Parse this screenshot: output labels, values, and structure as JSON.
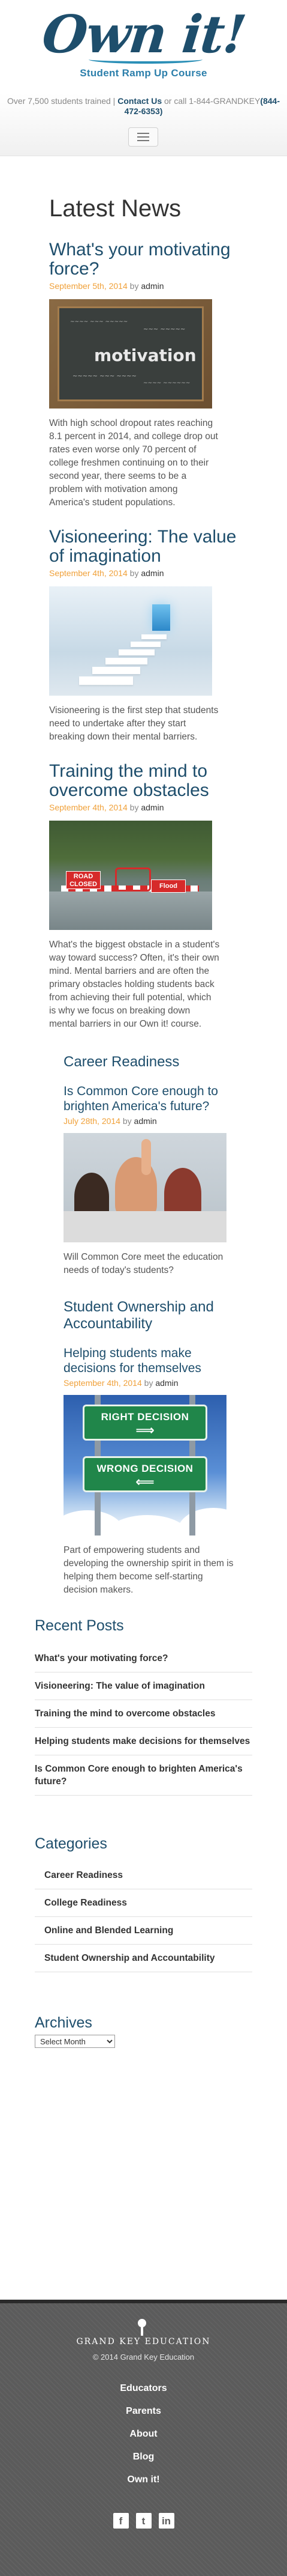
{
  "header": {
    "logo_text": "Own it!",
    "logo_tagline": "Student Ramp Up Course",
    "info_prefix": "Over 7,500 students trained |",
    "contact_link": "Contact Us",
    "info_mid": "or call 1-844-GRANDKEY",
    "phone": "(844-472-6353)",
    "menu_icon": "hamburger-menu-icon"
  },
  "main": {
    "page_title": "Latest News",
    "posts": [
      {
        "title": "What's your motivating force?",
        "date": "September 5th, 2014",
        "by": "by",
        "author": "admin",
        "excerpt": "With high school dropout rates reaching 8.1 percent in 2014, and college drop out rates even worse only 70 percent of college freshmen continuing on to their second year, there seems to be a problem with motivation among America's student populations."
      },
      {
        "title": "Visioneering: The value of imagination",
        "date": "September 4th, 2014",
        "by": "by",
        "author": "admin",
        "excerpt": "Visioneering is the first step that students need to undertake after they start breaking down their mental barriers."
      },
      {
        "title": "Training the mind to overcome obstacles",
        "date": "September 4th, 2014",
        "by": "by",
        "author": "admin",
        "excerpt": "What's the biggest obstacle in a student's way toward success? Often, it's their own mind. Mental barriers and are often the primary obstacles holding students back from achieving their full potential, which is why we focus on breaking down mental barriers in our Own it! course."
      }
    ],
    "chalkboard_word": "motivation",
    "flood_signs": [
      "ROAD CLOSED",
      "Flood"
    ],
    "categories": [
      {
        "heading": "Career Readiness",
        "post_title": "Is Common Core enough to brighten America's future?",
        "date": "July 28th, 2014",
        "by": "by",
        "author": "admin",
        "excerpt": "Will Common Core meet the education needs of today's students?"
      },
      {
        "heading": "Student Ownership and Accountability",
        "post_title": "Helping students make decisions for themselves",
        "date": "September 4th, 2014",
        "by": "by",
        "author": "admin",
        "excerpt": "Part of empowering students and developing the ownership spirit in them is helping them become self-starting decision makers."
      }
    ],
    "decision_signs": [
      "RIGHT DECISION",
      "WRONG DECISION"
    ]
  },
  "sidebar": {
    "recent_title": "Recent Posts",
    "recent_posts": [
      "What's your motivating force?",
      "Visioneering: The value of imagination",
      "Training the mind to overcome obstacles",
      "Helping students make decisions for themselves",
      "Is Common Core enough to brighten America's future?"
    ],
    "categories_title": "Categories",
    "categories": [
      "Career Readiness",
      "College Readiness",
      "Online and Blended Learning",
      "Student Ownership and Accountability"
    ],
    "archives_title": "Archives",
    "archives_select": "Select Month"
  },
  "footer": {
    "logo_name": "GRAND KEY EDUCATION",
    "copyright": "© 2014 Grand Key Education",
    "nav": [
      "Educators",
      "Parents",
      "About",
      "Blog",
      "Own it!"
    ],
    "social": [
      "facebook-icon",
      "twitter-icon",
      "linkedin-icon"
    ]
  },
  "colors": {
    "brand_blue": "#1e4e6c",
    "accent_blue": "#2c7fab",
    "date_orange": "#f0a13a",
    "footer_grey": "#5b5b5b"
  }
}
